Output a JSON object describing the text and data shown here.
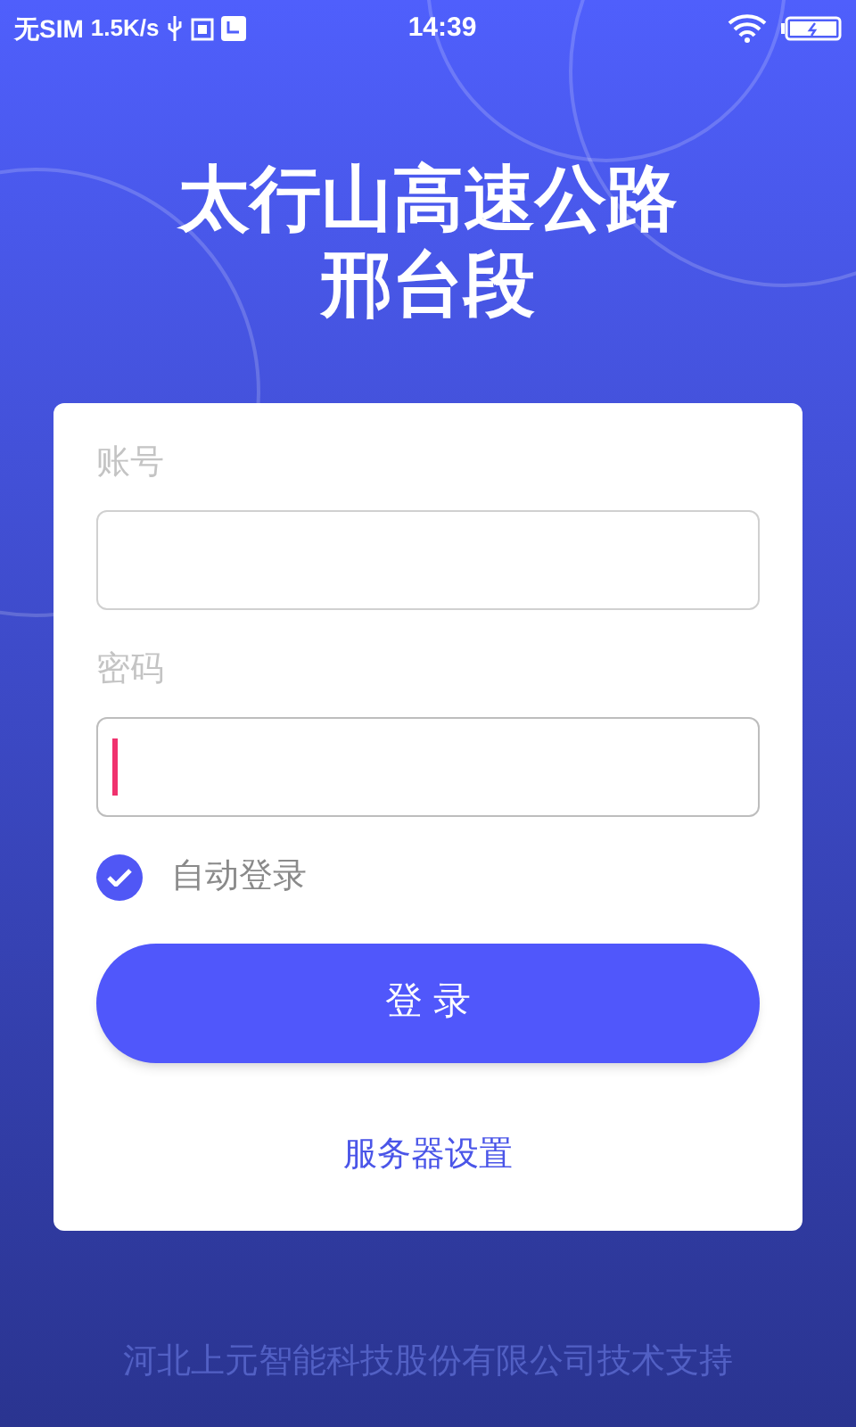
{
  "status_bar": {
    "carrier": "无SIM",
    "speed": "1.5K/s",
    "time": "14:39"
  },
  "title": [
    "太行山高速公路",
    "邢台段"
  ],
  "form": {
    "fields": [
      {
        "label": "账号",
        "focused": false
      },
      {
        "label": "密码",
        "focused": true
      }
    ],
    "auto_login": {
      "label": "自动登录",
      "checked": true
    },
    "login_button": "登 录",
    "server_link": "服务器设置"
  },
  "footer": "河北上元智能科技股份有限公司技术支持"
}
